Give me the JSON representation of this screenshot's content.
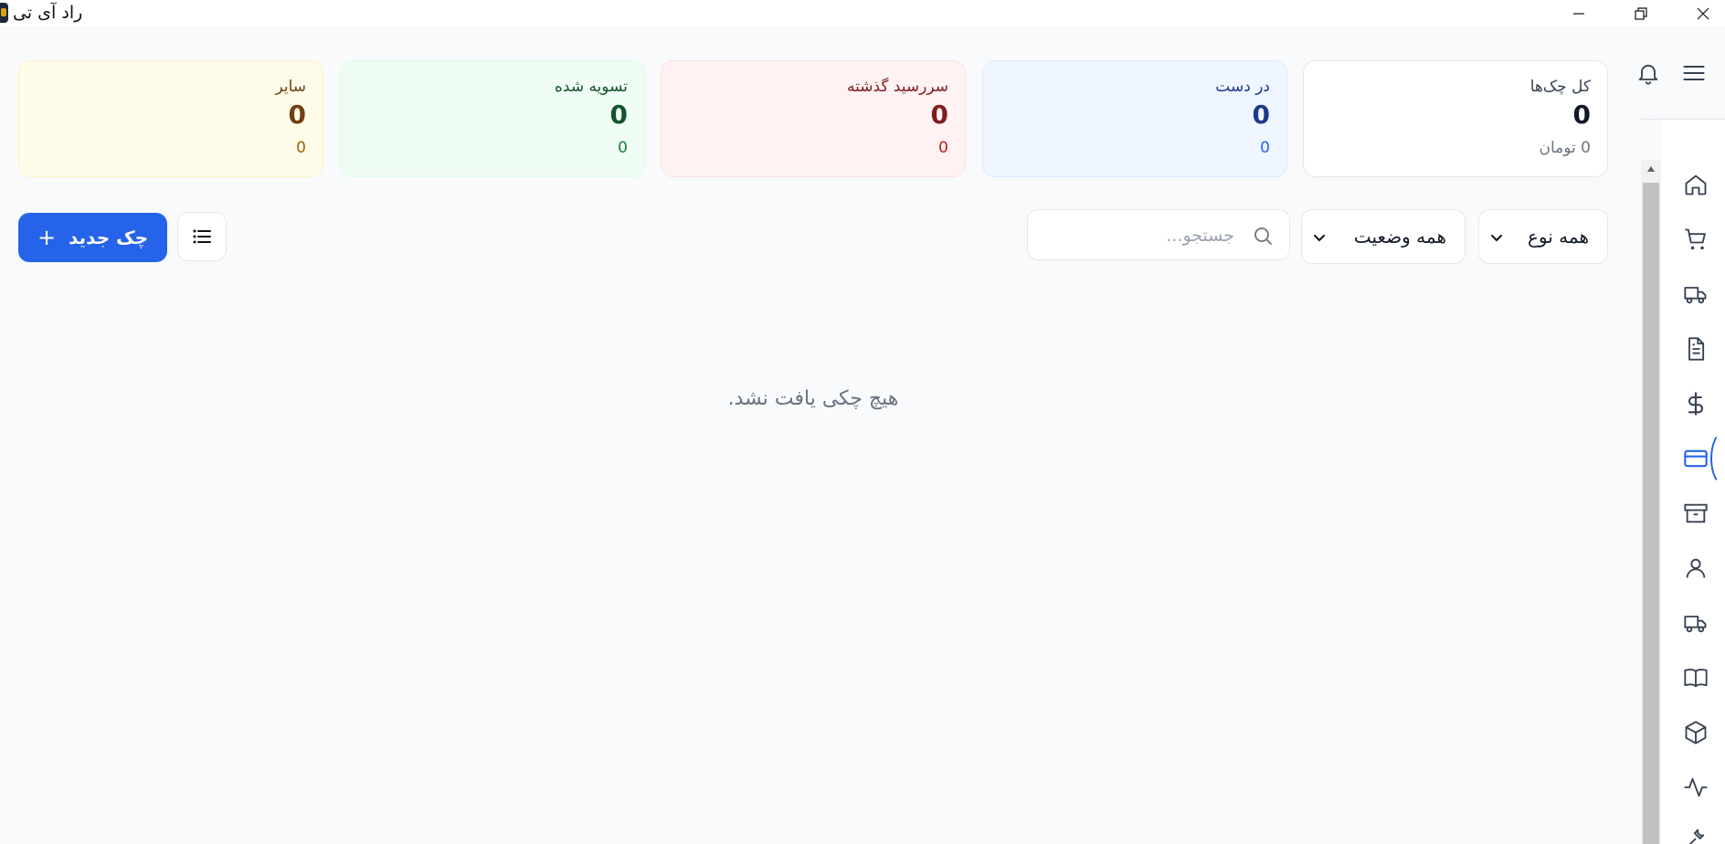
{
  "window": {
    "title": "راد آی تی"
  },
  "cards": {
    "total": {
      "title": "کل چک‌ها",
      "count": "0",
      "amount": "0 تومان"
    },
    "in_hand": {
      "title": "در دست",
      "count": "0",
      "amount": "0"
    },
    "overdue": {
      "title": "سررسید گذشته",
      "count": "0",
      "amount": "0"
    },
    "settled": {
      "title": "تسویه شده",
      "count": "0",
      "amount": "0"
    },
    "other": {
      "title": "سایر",
      "count": "0",
      "amount": "0"
    }
  },
  "filters": {
    "type_selected": "همه نوع",
    "status_selected": "همه وضعیت",
    "search_placeholder": "جستجو..."
  },
  "actions": {
    "new_cheque_label": "چک جدید",
    "new_cheque_icon": "+"
  },
  "empty_message": "هیچ چکی یافت نشد.",
  "colors": {
    "primary": "#2563eb",
    "background": "#f8fafc"
  },
  "sidebar_icons": [
    "home-icon",
    "cart-icon",
    "truck-icon",
    "document-icon",
    "dollar-icon",
    "credit-card-icon",
    "archive-icon",
    "user-icon",
    "delivery-truck-icon",
    "book-icon",
    "package-icon",
    "activity-icon",
    "tools-icon"
  ]
}
